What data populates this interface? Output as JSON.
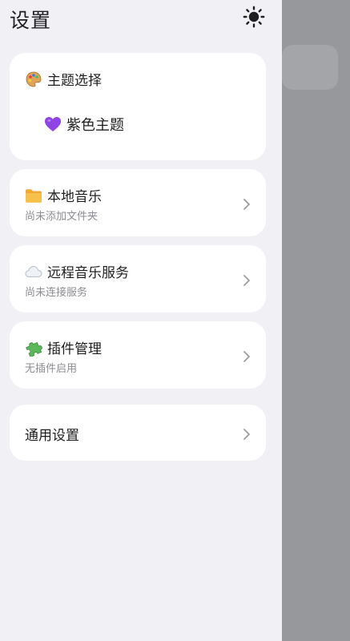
{
  "header": {
    "title": "设置",
    "theme_toggle_icon": "sun-icon"
  },
  "theme_card": {
    "icon": "palette-icon",
    "title": "主题选择",
    "selected_icon": "purple-heart-icon",
    "selected_label": "紫色主题"
  },
  "menu": [
    {
      "icon": "folder-icon",
      "title": "本地音乐",
      "subtitle": "尚未添加文件夹"
    },
    {
      "icon": "cloud-icon",
      "title": "远程音乐服务",
      "subtitle": "尚未连接服务"
    },
    {
      "icon": "puzzle-icon",
      "title": "插件管理",
      "subtitle": "无插件启用"
    },
    {
      "icon": "",
      "title": "通用设置",
      "subtitle": ""
    }
  ],
  "colors": {
    "drawer_bg": "#f1f1f5",
    "card_bg": "#ffffff",
    "scrim": "#97989b",
    "accent_purple": "#8e44e6"
  }
}
